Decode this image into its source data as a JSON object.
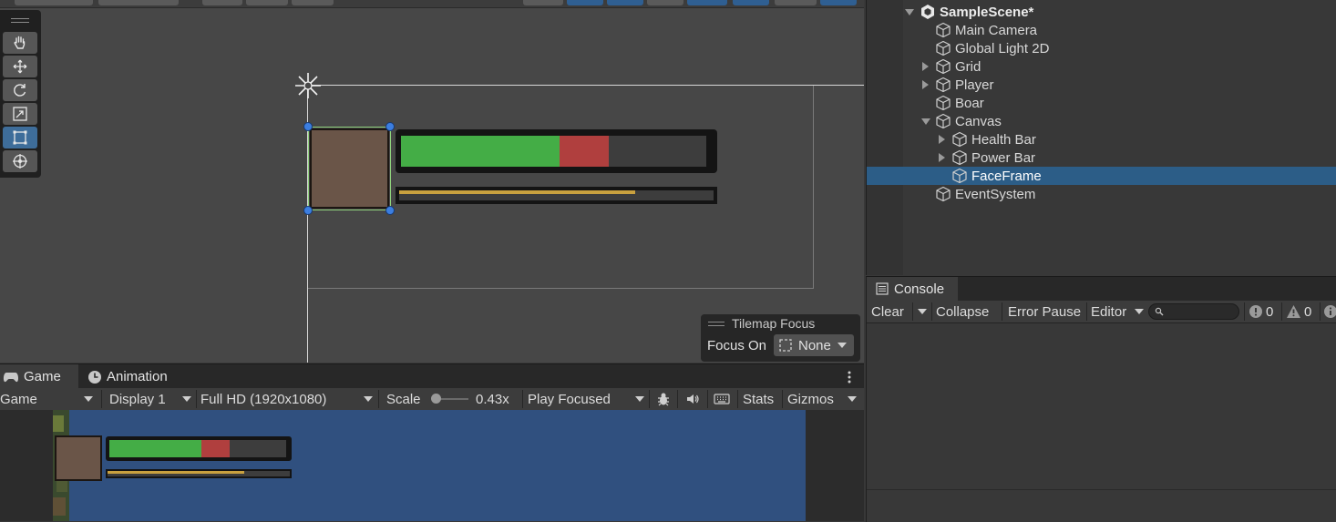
{
  "scene": {
    "tilemap_focus": {
      "title": "Tilemap Focus",
      "focus_label": "Focus On",
      "focus_value": "None"
    },
    "health_bar": {
      "green_fraction": 0.52,
      "red_fraction": 0.16
    },
    "power_bar": {
      "fill_fraction": 0.75
    }
  },
  "game": {
    "tabs": [
      "Game",
      "Animation"
    ],
    "toolbar": {
      "view_mode": "Game",
      "display": "Display 1",
      "resolution": "Full HD (1920x1080)",
      "scale_label": "Scale",
      "scale_value": "0.43x",
      "play_mode": "Play Focused",
      "stats": "Stats",
      "gizmos": "Gizmos"
    }
  },
  "hierarchy": {
    "scene_name": "SampleScene*",
    "items": [
      {
        "label": "Main Camera",
        "depth": 1,
        "foldout": "none"
      },
      {
        "label": "Global Light 2D",
        "depth": 1,
        "foldout": "none"
      },
      {
        "label": "Grid",
        "depth": 1,
        "foldout": "collapsed"
      },
      {
        "label": "Player",
        "depth": 1,
        "foldout": "collapsed"
      },
      {
        "label": "Boar",
        "depth": 1,
        "foldout": "none"
      },
      {
        "label": "Canvas",
        "depth": 1,
        "foldout": "expanded"
      },
      {
        "label": "Health Bar",
        "depth": 2,
        "foldout": "collapsed"
      },
      {
        "label": "Power Bar",
        "depth": 2,
        "foldout": "collapsed"
      },
      {
        "label": "FaceFrame",
        "depth": 2,
        "foldout": "none",
        "selected": true
      },
      {
        "label": "EventSystem",
        "depth": 1,
        "foldout": "none"
      }
    ]
  },
  "console": {
    "tab": "Console",
    "clear": "Clear",
    "collapse": "Collapse",
    "error_pause": "Error Pause",
    "editor": "Editor",
    "error_count": "0",
    "warning_count": "0"
  },
  "colors": {
    "selection": "#2c5d87",
    "health_green": "#44ad46",
    "health_red": "#b03f3e",
    "power_gold": "#c9a13f",
    "face": "#6a5548",
    "game_background": "#30507f"
  }
}
